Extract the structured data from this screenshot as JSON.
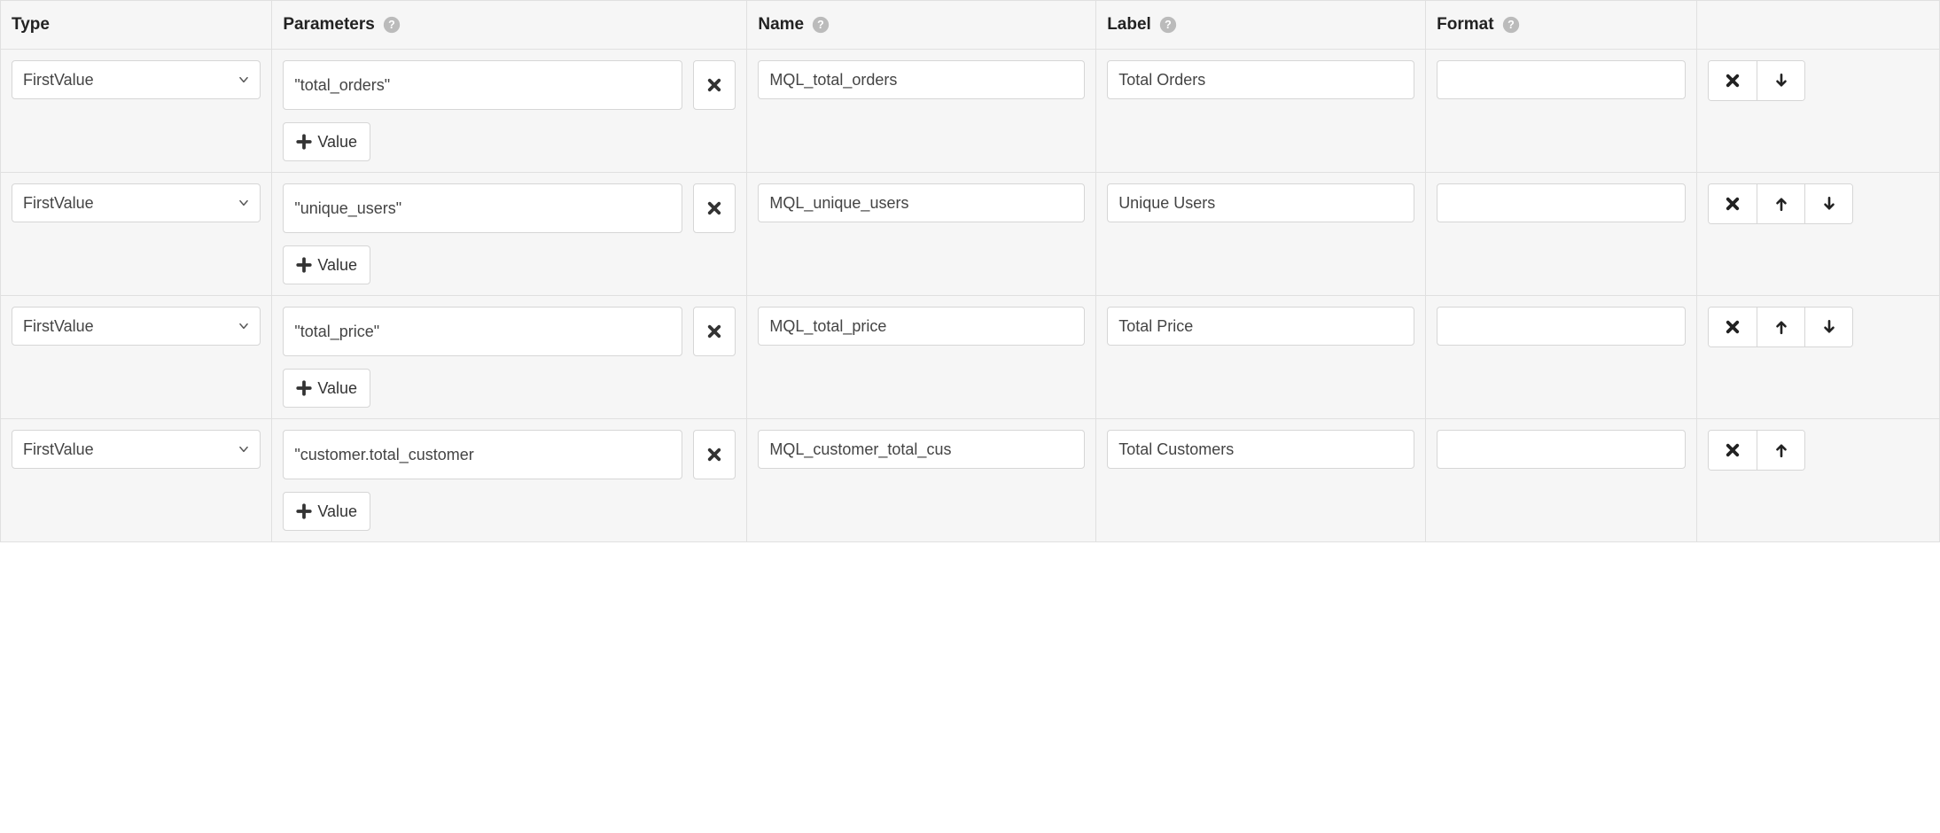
{
  "headers": {
    "type": "Type",
    "parameters": "Parameters",
    "name": "Name",
    "label": "Label",
    "format": "Format"
  },
  "add_value_label": "Value",
  "type_options": [
    "FirstValue"
  ],
  "rows": [
    {
      "type": "FirstValue",
      "parameter": "\"total_orders\"",
      "name": "MQL_total_orders",
      "label": "Total Orders",
      "format": "",
      "actions": {
        "delete": true,
        "up": false,
        "down": true
      }
    },
    {
      "type": "FirstValue",
      "parameter": "\"unique_users\"",
      "name": "MQL_unique_users",
      "label": "Unique Users",
      "format": "",
      "actions": {
        "delete": true,
        "up": true,
        "down": true
      }
    },
    {
      "type": "FirstValue",
      "parameter": "\"total_price\"",
      "name": "MQL_total_price",
      "label": "Total Price",
      "format": "",
      "actions": {
        "delete": true,
        "up": true,
        "down": true
      }
    },
    {
      "type": "FirstValue",
      "parameter": "\"customer.total_customer",
      "name": "MQL_customer_total_cus",
      "label": "Total Customers",
      "format": "",
      "actions": {
        "delete": true,
        "up": true,
        "down": false
      }
    }
  ]
}
